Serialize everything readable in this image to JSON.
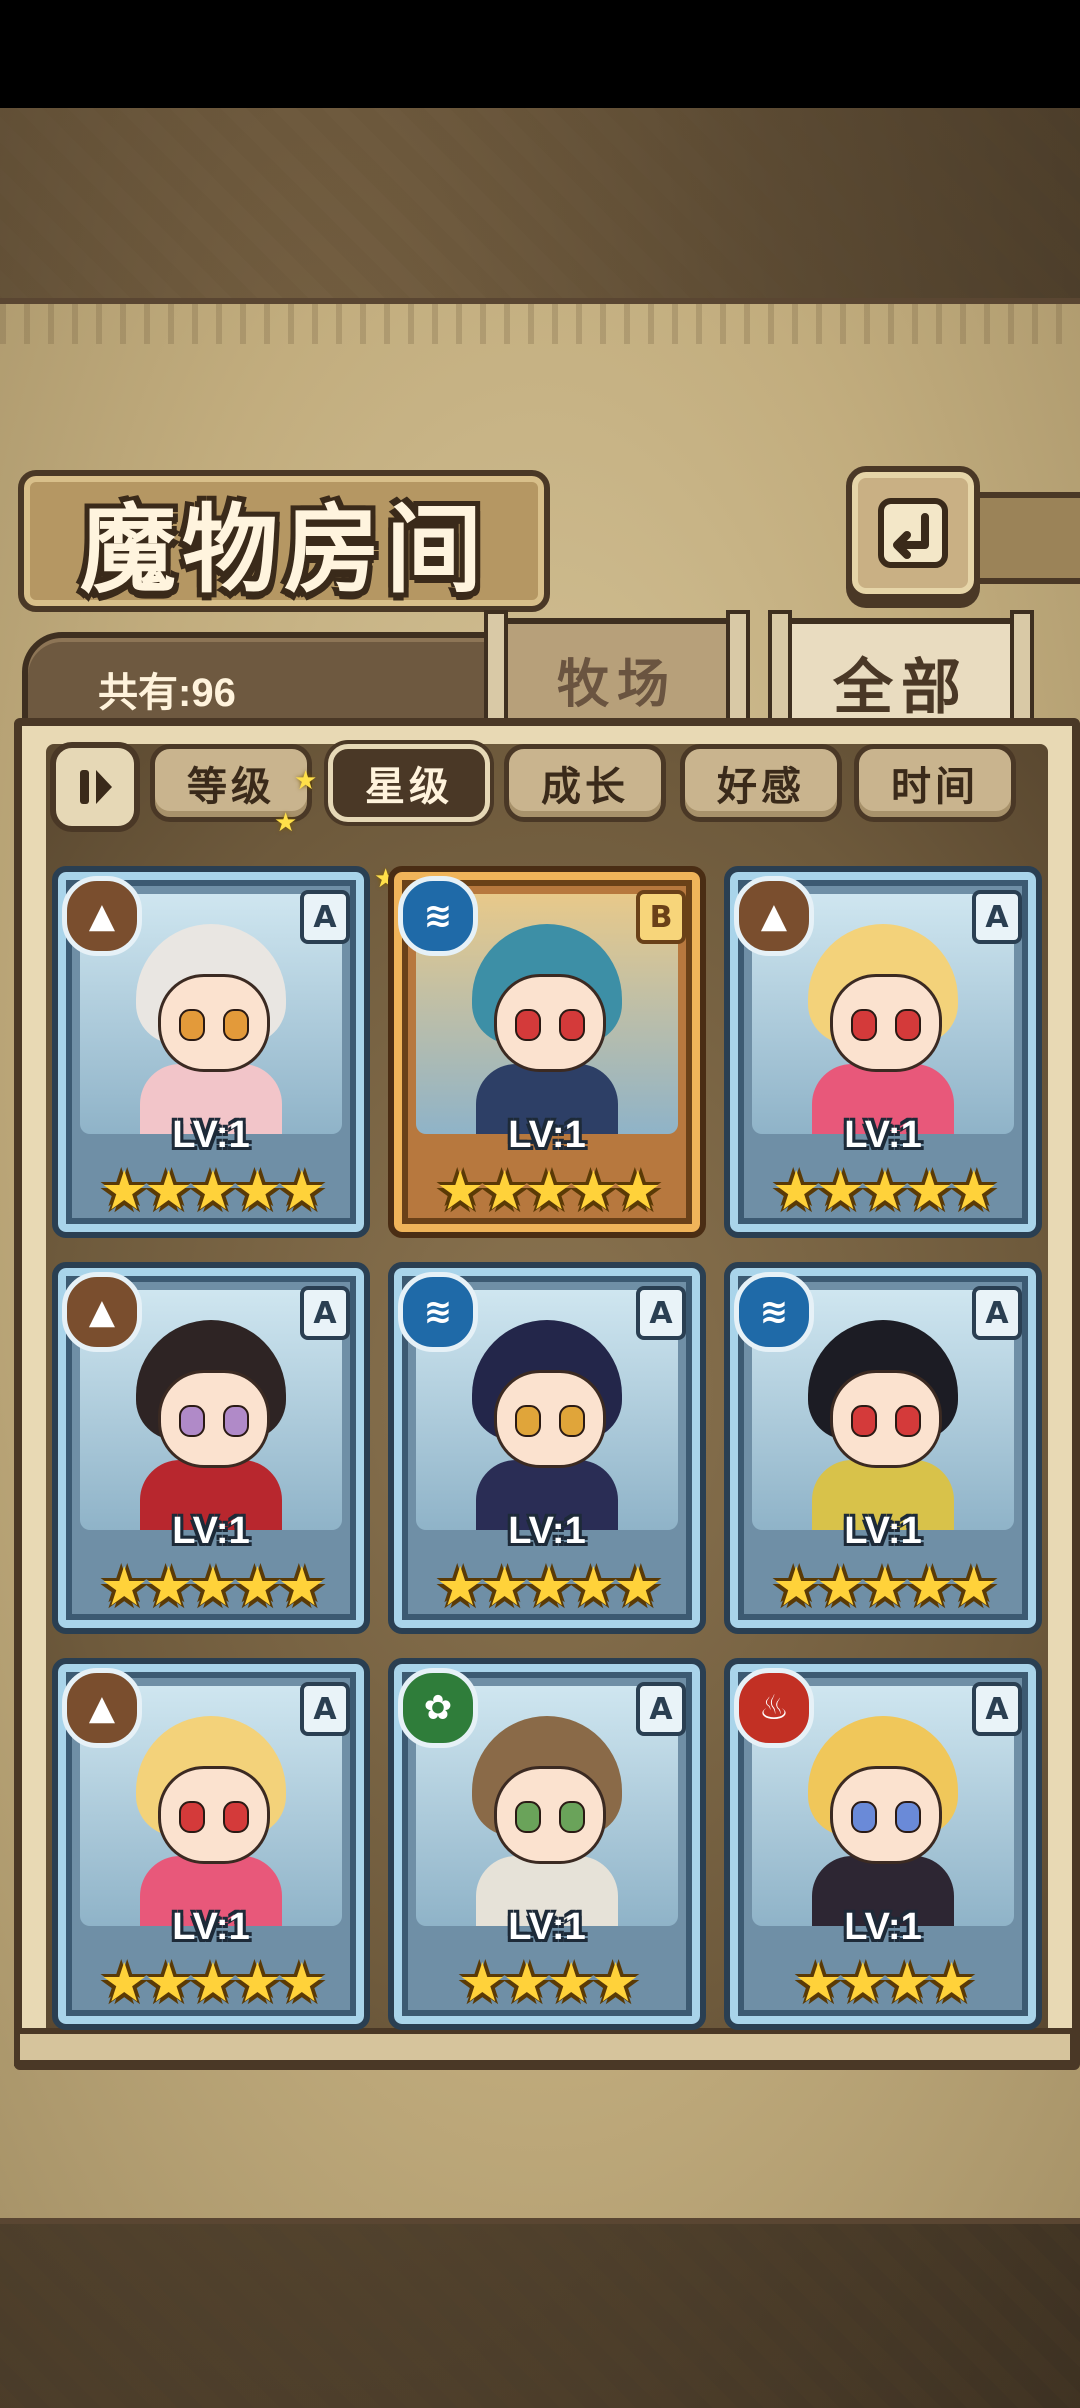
{
  "header": {
    "title": "魔物房间",
    "back_icon": "return-arrow-icon"
  },
  "summary": {
    "count_label": "共有:96"
  },
  "tabs": [
    {
      "label": "牧场",
      "active": false
    },
    {
      "label": "全部",
      "active": true
    }
  ],
  "filters": {
    "toggle_icon": "sort-toggle-icon",
    "options": [
      {
        "label": "等级",
        "active": false
      },
      {
        "label": "星级",
        "active": true
      },
      {
        "label": "成长",
        "active": false
      },
      {
        "label": "好感",
        "active": false
      },
      {
        "label": "时间",
        "active": false
      }
    ]
  },
  "monsters": [
    {
      "element": "earth",
      "element_icon": "mountain-icon",
      "rank": "A",
      "level": "LV:1",
      "stars": 5,
      "stars_text": "★★★★★",
      "frame": "blue",
      "hair": "#e9e6e2",
      "eye": "#e39a3a",
      "outfit": "#f2c5c9"
    },
    {
      "element": "water",
      "element_icon": "waves-icon",
      "rank": "B",
      "level": "LV:1",
      "stars": 5,
      "stars_text": "★★★★★",
      "frame": "gold",
      "hair": "#3d8fa6",
      "eye": "#d43a3a",
      "outfit": "#2d3f66"
    },
    {
      "element": "earth",
      "element_icon": "mountain-icon",
      "rank": "A",
      "level": "LV:1",
      "stars": 5,
      "stars_text": "★★★★★",
      "frame": "blue",
      "hair": "#f3d27a",
      "eye": "#d43a3a",
      "outfit": "#e8587a"
    },
    {
      "element": "earth",
      "element_icon": "mountain-icon",
      "rank": "A",
      "level": "LV:1",
      "stars": 5,
      "stars_text": "★★★★★",
      "frame": "blue",
      "hair": "#2e2424",
      "eye": "#b08ac8",
      "outfit": "#b8272e"
    },
    {
      "element": "water",
      "element_icon": "waves-icon",
      "rank": "A",
      "level": "LV:1",
      "stars": 5,
      "stars_text": "★★★★★",
      "frame": "blue",
      "hair": "#23264a",
      "eye": "#e0a53a",
      "outfit": "#2a2d55"
    },
    {
      "element": "water",
      "element_icon": "waves-icon",
      "rank": "A",
      "level": "LV:1",
      "stars": 5,
      "stars_text": "★★★★★",
      "frame": "blue",
      "hair": "#1c1c24",
      "eye": "#d43a3a",
      "outfit": "#d8c24a"
    },
    {
      "element": "earth",
      "element_icon": "mountain-icon",
      "rank": "A",
      "level": "LV:1",
      "stars": 5,
      "stars_text": "★★★★★",
      "frame": "blue",
      "hair": "#f3d27a",
      "eye": "#d43a3a",
      "outfit": "#e8587a"
    },
    {
      "element": "wood",
      "element_icon": "leaf-icon",
      "rank": "A",
      "level": "LV:1",
      "stars": 4,
      "stars_text": "★★★★",
      "frame": "blue",
      "hair": "#8a6a48",
      "eye": "#6aa35a",
      "outfit": "#e6e2d8"
    },
    {
      "element": "fire",
      "element_icon": "flame-icon",
      "rank": "A",
      "level": "LV:1",
      "stars": 4,
      "stars_text": "★★★★",
      "frame": "blue",
      "hair": "#f0c75a",
      "eye": "#6a8ad8",
      "outfit": "#2d2633"
    }
  ],
  "element_colors": {
    "earth": "#7a4e2e",
    "water": "#1f6aa8",
    "wood": "#2f7d3a",
    "fire": "#c23024"
  }
}
